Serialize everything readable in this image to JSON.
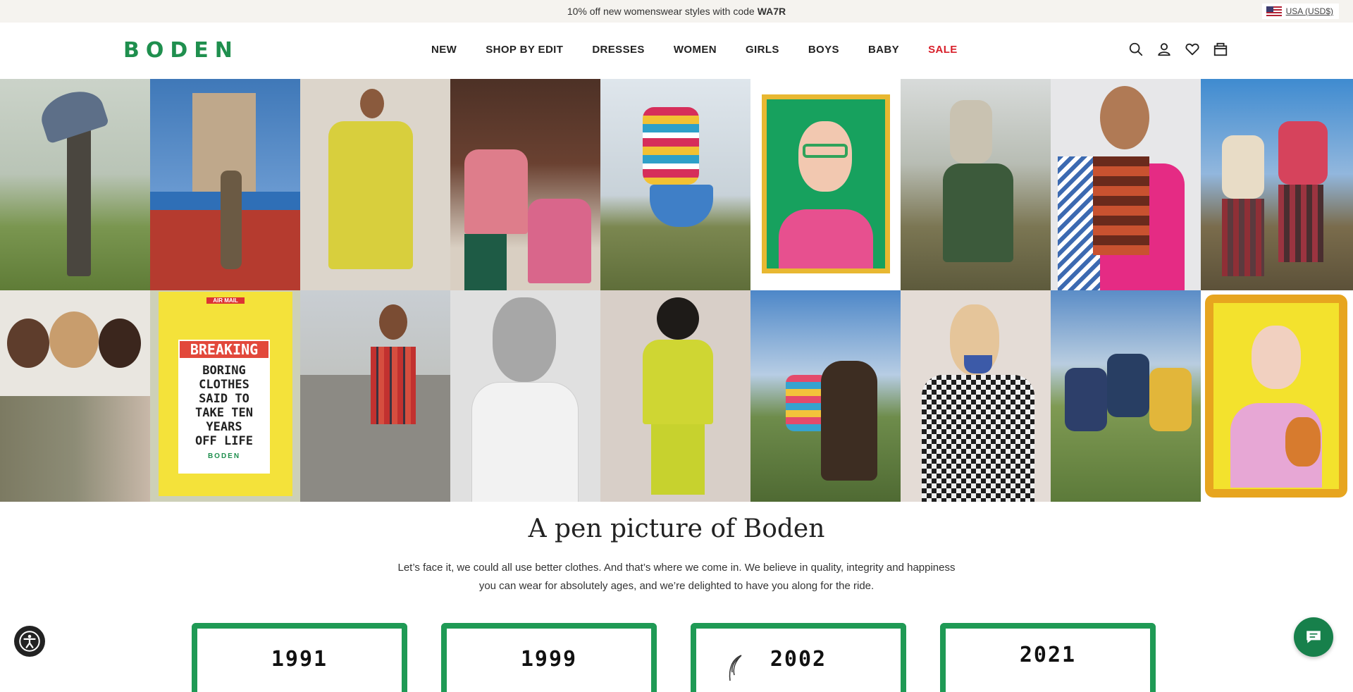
{
  "promo": {
    "text": "10% off new womenswear styles with code",
    "code": "WA7R"
  },
  "locale": {
    "label": "USA (USD$)"
  },
  "header": {
    "logo": "BODEN",
    "nav": [
      {
        "label": "NEW"
      },
      {
        "label": "SHOP BY EDIT"
      },
      {
        "label": "DRESSES"
      },
      {
        "label": "WOMEN"
      },
      {
        "label": "GIRLS"
      },
      {
        "label": "BOYS"
      },
      {
        "label": "BABY"
      },
      {
        "label": "SALE"
      }
    ],
    "icons": [
      "search-icon",
      "account-icon",
      "wishlist-heart-icon",
      "bag-icon"
    ]
  },
  "gallery": {
    "sign_lines": [
      "AIR MAIL",
      "BREAKING",
      "BORING",
      "CLOTHES",
      "SAID TO",
      "TAKE TEN",
      "YEARS",
      "OFF LIFE",
      "BODEN"
    ]
  },
  "about": {
    "title": "A pen picture of Boden",
    "line1": "Let’s face it, we could all use better clothes. And that’s where we come in. We believe in quality, integrity and happiness",
    "line2": "you can wear for absolutely ages, and we’re delighted to have you along for the ride."
  },
  "timeline": [
    {
      "year": "1991"
    },
    {
      "year": "1999"
    },
    {
      "year": "2002"
    },
    {
      "year": "2021"
    }
  ],
  "colors": {
    "brand_green": "#1f8f4e",
    "sale_red": "#d81f2a",
    "chat_green": "#17804b"
  }
}
